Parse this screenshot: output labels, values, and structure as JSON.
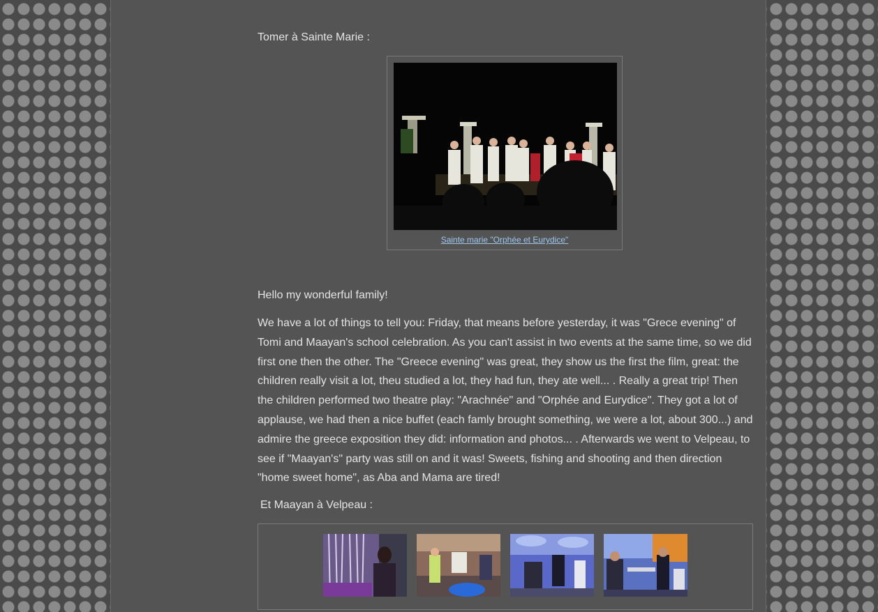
{
  "section1": {
    "heading": "Tomer à Sainte Marie :",
    "video_caption": "Sainte marie \"Orphée et Eurydice\""
  },
  "post": {
    "greeting": "Hello my wonderful family!",
    "body": "We have a lot of things to tell you: Friday, that means before yesterday, it was \"Grece evening\" of Tomi and Maayan's school celebration. As you can't assist in two events at the same time, so we did first one then the other. The \"Greece evening\" was great, they show us the first the film, great: the children really visit a lot, theu studied a lot, they had fun, they ate well... . Really a great trip! Then the children performed two theatre play: \"Arachnée\" and  \"Orphée and Eurydice\". They got a lot of applause, we had then a nice buffet (each famly brought something, we were a lot, about 300...) and admire the greece exposition they did: information and photos... . Afterwards we went to Velpeau, to see if \"Maayan's\" party was still on and it was! Sweets, fishing and shooting and then direction \"home sweet home\", as Aba and Mama are tired!"
  },
  "section2": {
    "heading": "Et Maayan à Velpeau :"
  },
  "colors": {
    "page_bg": "#545454",
    "text": "#e4e4e4",
    "link": "#9fc7ee",
    "border": "#7a7a7a"
  }
}
